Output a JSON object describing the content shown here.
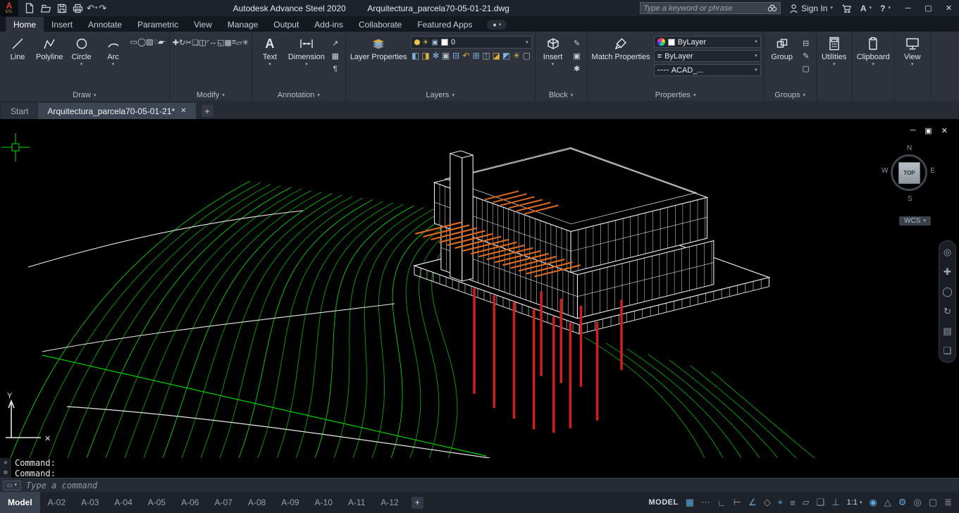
{
  "titlebar": {
    "badge_letter": "A",
    "badge_sub": "STL",
    "product": "Autodesk Advance Steel 2020",
    "document": "Arquitectura_parcela70-05-01-21.dwg",
    "search_placeholder": "Type a keyword or phrase",
    "signin": "Sign In",
    "help": "?",
    "window_controls": [
      {
        "name": "minimize-button",
        "glyph": "─"
      },
      {
        "name": "restore-button",
        "glyph": "▢"
      },
      {
        "name": "close-button",
        "glyph": "✕"
      }
    ]
  },
  "ribbon_tabs": [
    {
      "name": "tab-home",
      "label": "Home",
      "active": true
    },
    {
      "name": "tab-insert",
      "label": "Insert"
    },
    {
      "name": "tab-annotate",
      "label": "Annotate"
    },
    {
      "name": "tab-parametric",
      "label": "Parametric"
    },
    {
      "name": "tab-view",
      "label": "View"
    },
    {
      "name": "tab-manage",
      "label": "Manage"
    },
    {
      "name": "tab-output",
      "label": "Output"
    },
    {
      "name": "tab-addins",
      "label": "Add-ins"
    },
    {
      "name": "tab-collaborate",
      "label": "Collaborate"
    },
    {
      "name": "tab-featured-apps",
      "label": "Featured Apps"
    }
  ],
  "panels": {
    "draw": {
      "label": "Draw",
      "big": [
        {
          "label": "Line"
        },
        {
          "label": "Polyline"
        },
        {
          "label": "Circle"
        },
        {
          "label": "Arc"
        }
      ],
      "small": [
        {
          "name": "rectangle-icon",
          "glyph": "▭"
        },
        {
          "name": "ellipse-icon",
          "glyph": "◯"
        },
        {
          "name": "hatch-icon",
          "glyph": "▨"
        },
        {
          "name": "boundary-icon",
          "glyph": "◌"
        },
        {
          "name": "region-icon",
          "glyph": "▰"
        },
        {
          "name": "point-icon",
          "glyph": "∙"
        }
      ]
    },
    "modify": {
      "label": "Modify",
      "tools": [
        {
          "name": "move-icon",
          "glyph": "✚"
        },
        {
          "name": "rotate-icon",
          "glyph": "↻"
        },
        {
          "name": "trim-icon",
          "glyph": "✂"
        },
        {
          "name": "copy-icon",
          "glyph": "❏"
        },
        {
          "name": "mirror-icon",
          "glyph": "◫"
        },
        {
          "name": "fillet-icon",
          "glyph": "◜"
        },
        {
          "name": "stretch-icon",
          "glyph": "↔"
        },
        {
          "name": "scale-icon",
          "glyph": "◱"
        },
        {
          "name": "array-icon",
          "glyph": "▦"
        },
        {
          "name": "offset-icon",
          "glyph": "≡"
        },
        {
          "name": "erase-icon",
          "glyph": "▱"
        },
        {
          "name": "explode-icon",
          "glyph": "✳"
        }
      ]
    },
    "annotation": {
      "label": "Annotation",
      "text_tool": "Text",
      "dimension_tool": "Dimension",
      "small": [
        {
          "name": "leader-icon",
          "glyph": "↗"
        },
        {
          "name": "table-icon",
          "glyph": "▦"
        },
        {
          "name": "text-style-icon",
          "glyph": "¶"
        }
      ]
    },
    "layers": {
      "label": "Layers",
      "layer_properties": "Layer Properties",
      "current_layer": "0",
      "tools": [
        {
          "name": "layer-off-icon",
          "glyph": "◧",
          "color": "#7fb2d9"
        },
        {
          "name": "layer-isolate-icon",
          "glyph": "◨",
          "color": "#d4b23e"
        },
        {
          "name": "layer-freeze-icon",
          "glyph": "❄",
          "color": "#8fc3e8"
        },
        {
          "name": "layer-lock-icon",
          "glyph": "▣",
          "color": "#b9c3d0"
        },
        {
          "name": "layer-match-icon",
          "glyph": "⊟",
          "color": "#7fb2d9"
        },
        {
          "name": "layer-previous-icon",
          "glyph": "↶",
          "color": "#d4b23e"
        },
        {
          "name": "layer-walk-icon",
          "glyph": "⊞",
          "color": "#7fb2d9"
        },
        {
          "name": "layer-merge-icon",
          "glyph": "◫",
          "color": "#9fb0c0"
        },
        {
          "name": "layer-delete-icon",
          "glyph": "◪",
          "color": "#d4b23e"
        },
        {
          "name": "layer-on-icon",
          "glyph": "◩",
          "color": "#7fb2d9"
        },
        {
          "name": "layer-thaw-icon",
          "glyph": "☀",
          "color": "#d4b23e"
        },
        {
          "name": "layer-unlock-icon",
          "glyph": "▢",
          "color": "#9fb0c0"
        }
      ]
    },
    "block": {
      "label": "Block",
      "insert": "Insert",
      "small": [
        {
          "name": "block-edit-icon",
          "glyph": "✎"
        },
        {
          "name": "block-define-icon",
          "glyph": "▣"
        },
        {
          "name": "block-attributes-icon",
          "glyph": "✱"
        }
      ]
    },
    "properties": {
      "label": "Properties",
      "match": "Match Properties",
      "color_value": "ByLayer",
      "lineweight_value": "ByLayer",
      "linetype_value": "ACAD_..."
    },
    "groups": {
      "label": "Groups",
      "group": "Group",
      "small": [
        {
          "name": "ungroup-icon",
          "glyph": "⊟"
        },
        {
          "name": "group-edit-icon",
          "glyph": "✎"
        },
        {
          "name": "group-select-icon",
          "glyph": "▢"
        }
      ]
    },
    "utilities": {
      "label": "Utilities"
    },
    "clipboard": {
      "label": "Clipboard"
    },
    "view": {
      "label": "View"
    }
  },
  "file_tabs": [
    {
      "name": "file-tab-start",
      "label": "Start"
    },
    {
      "name": "file-tab-document",
      "label": "Arquitectura_parcela70-05-01-21*",
      "active": true
    }
  ],
  "canvas": {
    "window_controls": [
      {
        "name": "viewport-minimize-button",
        "glyph": "─"
      },
      {
        "name": "viewport-restore-button",
        "glyph": "▣"
      },
      {
        "name": "viewport-close-button",
        "glyph": "✕"
      }
    ]
  },
  "viewcube": {
    "north": "N",
    "south": "S",
    "east": "E",
    "west": "W",
    "top": "TOP",
    "wcs": "WCS"
  },
  "navbar": {
    "icons": [
      {
        "name": "nav-wheel-icon",
        "glyph": "◎"
      },
      {
        "name": "pan-icon",
        "glyph": "✚"
      },
      {
        "name": "zoom-icon",
        "glyph": "◯"
      },
      {
        "name": "orbit-icon",
        "glyph": "↻"
      },
      {
        "name": "showmotion-icon",
        "glyph": "▤"
      },
      {
        "name": "layout-stack-icon",
        "glyph": "❏"
      }
    ]
  },
  "command": {
    "lines": [
      "Command:",
      "Command:"
    ],
    "placeholder": "Type a command"
  },
  "layout_tabs": [
    {
      "name": "layout-tab-model",
      "label": "Model",
      "active": true
    },
    {
      "name": "layout-tab-a02",
      "label": "A-02"
    },
    {
      "name": "layout-tab-a03",
      "label": "A-03"
    },
    {
      "name": "layout-tab-a04",
      "label": "A-04"
    },
    {
      "name": "layout-tab-a05",
      "label": "A-05"
    },
    {
      "name": "layout-tab-a06",
      "label": "A-06"
    },
    {
      "name": "layout-tab-a07",
      "label": "A-07"
    },
    {
      "name": "layout-tab-a08",
      "label": "A-08"
    },
    {
      "name": "layout-tab-a09",
      "label": "A-09"
    },
    {
      "name": "layout-tab-a10",
      "label": "A-10"
    },
    {
      "name": "layout-tab-a11",
      "label": "A-11"
    },
    {
      "name": "layout-tab-a12",
      "label": "A-12"
    }
  ],
  "statusbar": {
    "model_label": "MODEL",
    "scale": "1:1",
    "icons_a": [
      {
        "name": "grid-icon",
        "glyph": "▦",
        "active": true
      },
      {
        "name": "snap-icon",
        "glyph": "⋯"
      },
      {
        "name": "infer-icon",
        "glyph": "∟"
      },
      {
        "name": "ortho-icon",
        "glyph": "⊢"
      },
      {
        "name": "polar-icon",
        "glyph": "∠",
        "active": true
      },
      {
        "name": "isodraft-icon",
        "glyph": "◇"
      },
      {
        "name": "osnap-icon",
        "glyph": "⌖",
        "active": true
      },
      {
        "name": "lineweight-icon",
        "glyph": "≡"
      },
      {
        "name": "transparency-icon",
        "glyph": "▱"
      },
      {
        "name": "selection-cycling-icon",
        "glyph": "❏"
      },
      {
        "name": "dynamic-ucs-icon",
        "glyph": "⊥",
        "active": true
      }
    ],
    "icons_b": [
      {
        "name": "annotation-visibility-icon",
        "glyph": "◉",
        "active": true
      },
      {
        "name": "autoscale-icon",
        "glyph": "△"
      },
      {
        "name": "workspace-icon",
        "glyph": "⚙",
        "active": true
      },
      {
        "name": "isolate-objects-icon",
        "glyph": "◎"
      },
      {
        "name": "clean-screen-icon",
        "glyph": "▢"
      },
      {
        "name": "customization-icon",
        "glyph": "≣"
      }
    ]
  },
  "drawing": {
    "colors": {
      "contour": "#00a400",
      "contour_bright": "#00d400",
      "white": "#e8e8e8",
      "pile": "#cf1f1f",
      "joist": "#d9691e",
      "crosshair": "#00e000"
    }
  }
}
